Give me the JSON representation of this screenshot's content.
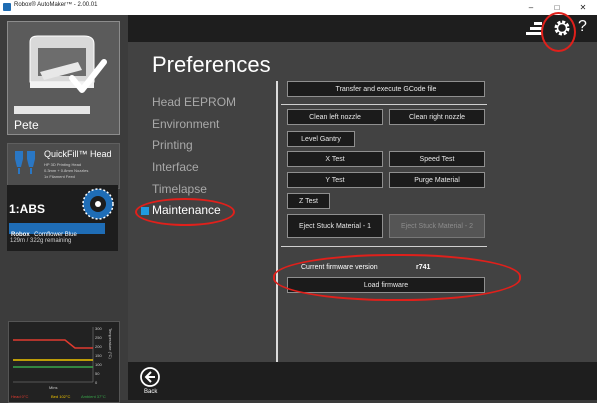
{
  "window": {
    "title": "Robox® AutoMaker™ - 2.00.01",
    "minimize_glyph": "–",
    "maximize_glyph": "□",
    "close_glyph": "✕"
  },
  "sidebar": {
    "printer": {
      "name": "Pete"
    },
    "head": {
      "brand": "QuickFill™",
      "brand_suffix": "Head",
      "line1": "HP 3D Printing Head",
      "line2": "0.3mm + 0.8mm Nozzles",
      "line3": "1x Filament Feed"
    },
    "material": {
      "slot": "1:ABS",
      "brand": "Robox",
      "color_name": "Cornflower Blue",
      "remaining": "129m / 322g remaining"
    },
    "graph": {
      "ylabel": "Temperature (°C)",
      "yticks": [
        "300",
        "250",
        "200",
        "150",
        "100",
        "50",
        "0"
      ],
      "xlabel": "Mins",
      "legend_head": "Head 0°C",
      "legend_bed": "Bed 102°C",
      "legend_ambient": "Ambient 37°C"
    }
  },
  "topbar": {
    "help_glyph": "?"
  },
  "preferences": {
    "heading": "Preferences",
    "categories": [
      {
        "label": "Head EEPROM"
      },
      {
        "label": "Environment"
      },
      {
        "label": "Printing"
      },
      {
        "label": "Interface"
      },
      {
        "label": "Timelapse"
      },
      {
        "label": "Maintenance"
      }
    ]
  },
  "maintenance": {
    "transfer_gcode": "Transfer and execute GCode file",
    "clean_left": "Clean left nozzle",
    "clean_right": "Clean right nozzle",
    "level_gantry": "Level Gantry",
    "x_test": "X Test",
    "speed_test": "Speed Test",
    "y_test": "Y Test",
    "purge_material": "Purge Material",
    "z_test": "Z Test",
    "eject_1": "Eject Stuck Material - 1",
    "eject_2": "Eject Stuck Material - 2",
    "firmware_label": "Current firmware version",
    "firmware_value": "r741",
    "load_firmware": "Load firmware"
  },
  "bottombar": {
    "back_label": "Back"
  },
  "colors": {
    "accent": "#1f6db6",
    "annotation": "#e0201b",
    "button_bg": "#1b1b1b",
    "panel_bg": "#424242"
  }
}
